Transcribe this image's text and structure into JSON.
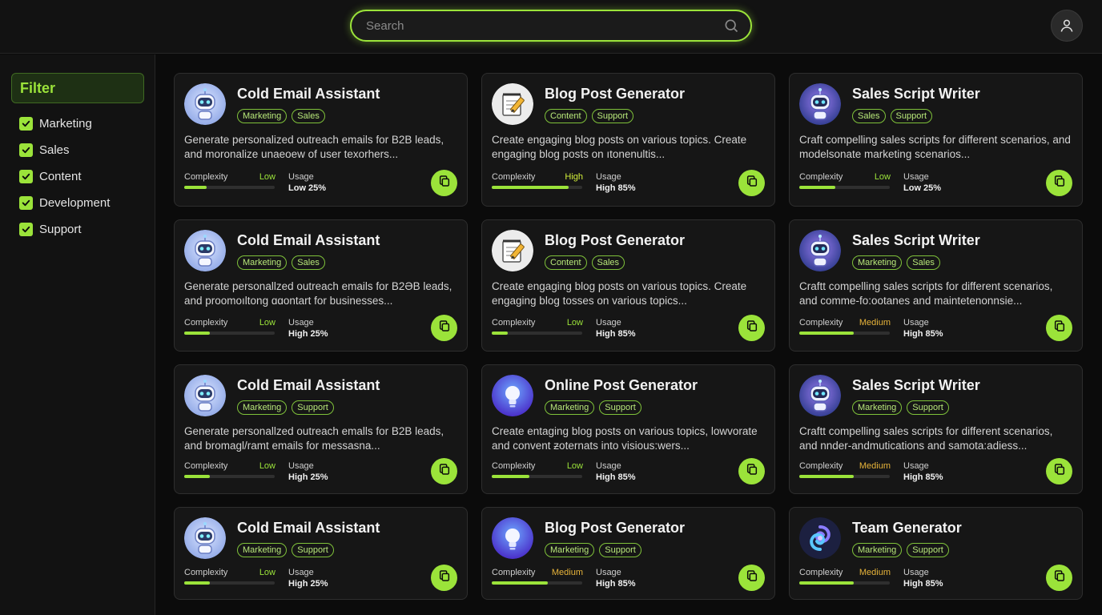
{
  "search": {
    "placeholder": "Search"
  },
  "sidebar": {
    "title": "Filter",
    "items": [
      {
        "label": "Marketing",
        "checked": true
      },
      {
        "label": "Sales",
        "checked": true
      },
      {
        "label": "Content",
        "checked": true
      },
      {
        "label": "Development",
        "checked": true
      },
      {
        "label": "Support",
        "checked": true
      }
    ]
  },
  "labels": {
    "complexity": "Complexity",
    "usage": "Usage"
  },
  "colors": {
    "accent": "#9be33a",
    "background": "#0b0b0b",
    "card": "#161616",
    "medium": "#e8b43a"
  },
  "cards": [
    {
      "title": "Cold Email Assistant",
      "icon": "robot-icon",
      "tags": [
        "Marketing",
        "Sales"
      ],
      "desc": "Generate personalized outreach emails for B2B leads, and moronalize unaeoew of user texorhers...",
      "complexity": "Low",
      "complexity_level": "low",
      "complexity_progress": 0.25,
      "usage": "Low 25%"
    },
    {
      "title": "Blog Post Generator",
      "icon": "notepad-pencil-icon",
      "tags": [
        "Content",
        "Support"
      ],
      "desc": "Create engaging blog posts on various topics. Create engaging blog posts on ıtonenultis...",
      "complexity": "High",
      "complexity_level": "high",
      "complexity_progress": 0.85,
      "usage": "High 85%"
    },
    {
      "title": "Sales Script Writer",
      "icon": "robot-purple-icon",
      "tags": [
        "Sales",
        "Support"
      ],
      "desc": "Craft compelling sales scripts for different scenarios, and modelsonate marketing scenarios...",
      "complexity": "Low",
      "complexity_level": "low",
      "complexity_progress": 0.4,
      "usage": "Low 25%"
    },
    {
      "title": "Cold Email Assistant",
      "icon": "robot-icon",
      "tags": [
        "Marketing",
        "Sales"
      ],
      "desc": "Generate personallzed outreach emails for B2ƏB leads, and proomoıltong ɑɑontart for businesses...",
      "complexity": "Low",
      "complexity_level": "low",
      "complexity_progress": 0.28,
      "usage": "High 25%"
    },
    {
      "title": "Blog Post Generator",
      "icon": "notepad-pencil-icon",
      "tags": [
        "Content",
        "Sales"
      ],
      "desc": "Create engaging blog posts on various topics. Create engaging blog tosses on various topics...",
      "complexity": "Low",
      "complexity_level": "low",
      "complexity_progress": 0.18,
      "usage": "High 85%"
    },
    {
      "title": "Sales Script Writer",
      "icon": "robot-purple-icon",
      "tags": [
        "Marketing",
        "Sales"
      ],
      "desc": "Craftt compelling sales scripts for different scenarios, and comme-fo:ootanes and maintetenonnsie...",
      "complexity": "Medium",
      "complexity_level": "medium",
      "complexity_progress": 0.6,
      "usage": "High 85%"
    },
    {
      "title": "Cold Email Assistant",
      "icon": "robot-icon",
      "tags": [
        "Marketing",
        "Support"
      ],
      "desc": "Generate personallzed outreach emalls for B2B leads, and bromagl/ramt emails for messasna...",
      "complexity": "Low",
      "complexity_level": "low",
      "complexity_progress": 0.28,
      "usage": "High 25%"
    },
    {
      "title": "Online Post Generator",
      "icon": "lightbulb-icon",
      "tags": [
        "Marketing",
        "Support"
      ],
      "desc": "Create entaging blog posts on various topics, lowvorate and convent ƶoternats into visious:wers...",
      "complexity": "Low",
      "complexity_level": "low",
      "complexity_progress": 0.42,
      "usage": "High 85%"
    },
    {
      "title": "Sales Script Writer",
      "icon": "robot-purple-icon",
      "tags": [
        "Marketing",
        "Support"
      ],
      "desc": "Craftt compelling sales scripts for different scenarios, and nnder-andmutications and samota:adiess...",
      "complexity": "Medium",
      "complexity_level": "medium",
      "complexity_progress": 0.6,
      "usage": "High 85%"
    },
    {
      "title": "Cold Email Assistant",
      "icon": "robot-icon",
      "tags": [
        "Marketing",
        "Support"
      ],
      "desc": "",
      "complexity": "Low",
      "complexity_level": "low",
      "complexity_progress": 0.28,
      "usage": "High 25%"
    },
    {
      "title": "Blog Post Generator",
      "icon": "lightbulb-icon",
      "tags": [
        "Marketing",
        "Support"
      ],
      "desc": "",
      "complexity": "Medium",
      "complexity_level": "medium",
      "complexity_progress": 0.62,
      "usage": "High 85%"
    },
    {
      "title": "Team Generator",
      "icon": "swirl-logo-icon",
      "tags": [
        "Marketing",
        "Support"
      ],
      "desc": "",
      "complexity": "Medium",
      "complexity_level": "medium",
      "complexity_progress": 0.6,
      "usage": "High 85%"
    }
  ]
}
